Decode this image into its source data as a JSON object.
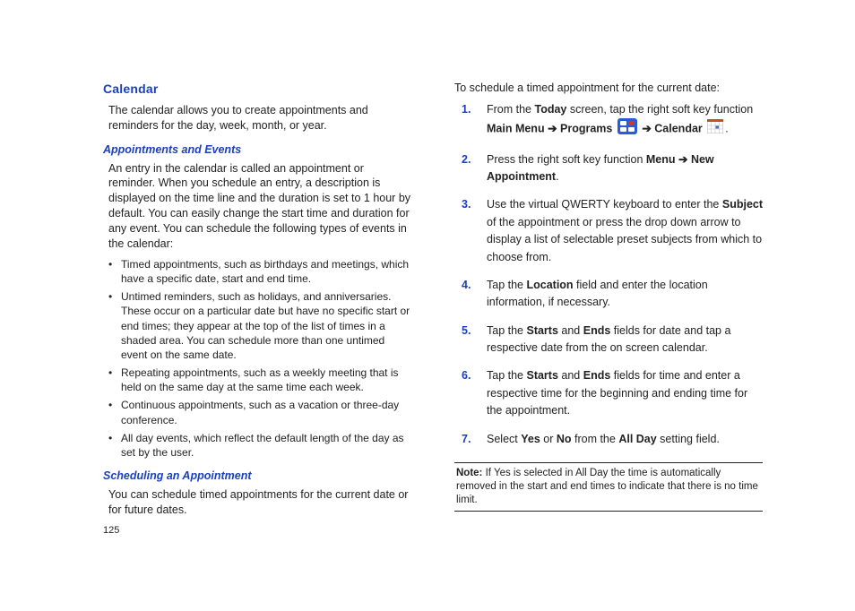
{
  "pageNumber": "125",
  "left": {
    "heading": "Calendar",
    "intro": "The calendar allows you to create appointments and reminders for the day, week, month, or year.",
    "sub1": "Appointments and Events",
    "para1": "An entry in the calendar is called an appointment or reminder. When you schedule an entry, a description is displayed on the time line and the duration is set to 1 hour by default. You can easily change the start time and duration for any event. You can schedule the following types of events in the calendar:",
    "bullets": [
      "Timed appointments, such as birthdays and meetings, which have a specific date, start and end time.",
      "Untimed reminders, such as holidays, and anniversaries. These occur on a particular date but have no specific start or end times; they appear at the top of the list of times in a shaded area. You can schedule more than one untimed event on the same date.",
      "Repeating appointments, such as a weekly meeting that is held on the same day at the same time each week.",
      "Continuous appointments, such as a vacation or three-day conference.",
      "All day events, which reflect the default length of the day as set by the user."
    ],
    "sub2": "Scheduling an Appointment",
    "para2": "You can schedule timed appointments for the current date or for future dates."
  },
  "right": {
    "intro": "To schedule a timed appointment for the current date:",
    "steps": {
      "s1": {
        "n": "1.",
        "a": "From the ",
        "b1": "Today",
        "b": " screen, tap the right soft key function ",
        "b2": "Main Menu",
        "c": " ➔ ",
        "b3": "Programs",
        "d": " ",
        "e": " ➔ ",
        "b4": "Calendar",
        "f": " ",
        "g": "."
      },
      "s2": {
        "n": "2.",
        "a": "Press the right soft key function ",
        "b1": "Menu",
        "b": " ➔ ",
        "b2": "New Appointment",
        "c": "."
      },
      "s3": {
        "n": "3.",
        "a": "Use the virtual QWERTY keyboard to enter the ",
        "b1": "Subject",
        "b": " of the appointment or press the drop down arrow to display a list of selectable preset subjects from which to choose from."
      },
      "s4": {
        "n": "4.",
        "a": "Tap the ",
        "b1": "Location",
        "b": " field and enter the location information, if necessary."
      },
      "s5": {
        "n": "5.",
        "a": "Tap the ",
        "b1": "Starts",
        "b": " and ",
        "b2": "Ends",
        "c": " fields for date and tap a respective date from the on screen calendar."
      },
      "s6": {
        "n": "6.",
        "a": "Tap the ",
        "b1": "Starts",
        "b": " and ",
        "b2": "Ends",
        "c": " fields for time and enter a respective time for the beginning and ending time for the appointment."
      },
      "s7": {
        "n": "7.",
        "a": "Select ",
        "b1": "Yes",
        "b": " or ",
        "b2": "No",
        "c": " from the ",
        "b3": "All Day",
        "d": " setting field."
      }
    },
    "note": {
      "label": "Note:",
      "text": " If Yes is selected in All Day the time is automatically removed in the start and end times to indicate that there is no time limit."
    }
  }
}
